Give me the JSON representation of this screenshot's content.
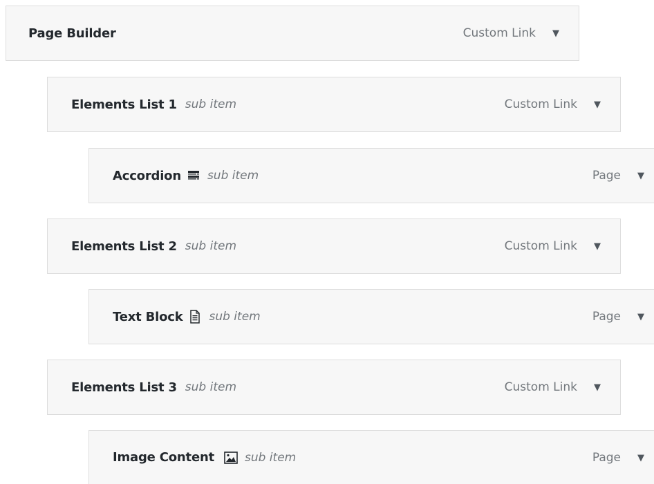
{
  "menu": {
    "items": [
      {
        "title": "Page Builder",
        "sub_label": "",
        "type_label": "Custom Link",
        "icon": ""
      },
      {
        "title": "Elements List 1",
        "sub_label": "sub item",
        "type_label": "Custom Link",
        "icon": ""
      },
      {
        "title": "Accordion",
        "sub_label": "sub item",
        "type_label": "Page",
        "icon": "accordion-icon"
      },
      {
        "title": "Elements List 2",
        "sub_label": "sub item",
        "type_label": "Custom Link",
        "icon": ""
      },
      {
        "title": "Text Block",
        "sub_label": "sub item",
        "type_label": "Page",
        "icon": "document-icon"
      },
      {
        "title": "Elements List 3",
        "sub_label": "sub item",
        "type_label": "Custom Link",
        "icon": ""
      },
      {
        "title": "Image Content",
        "sub_label": "sub item",
        "type_label": "Page",
        "icon": "image-icon"
      }
    ],
    "arrow_glyph": "▼"
  }
}
